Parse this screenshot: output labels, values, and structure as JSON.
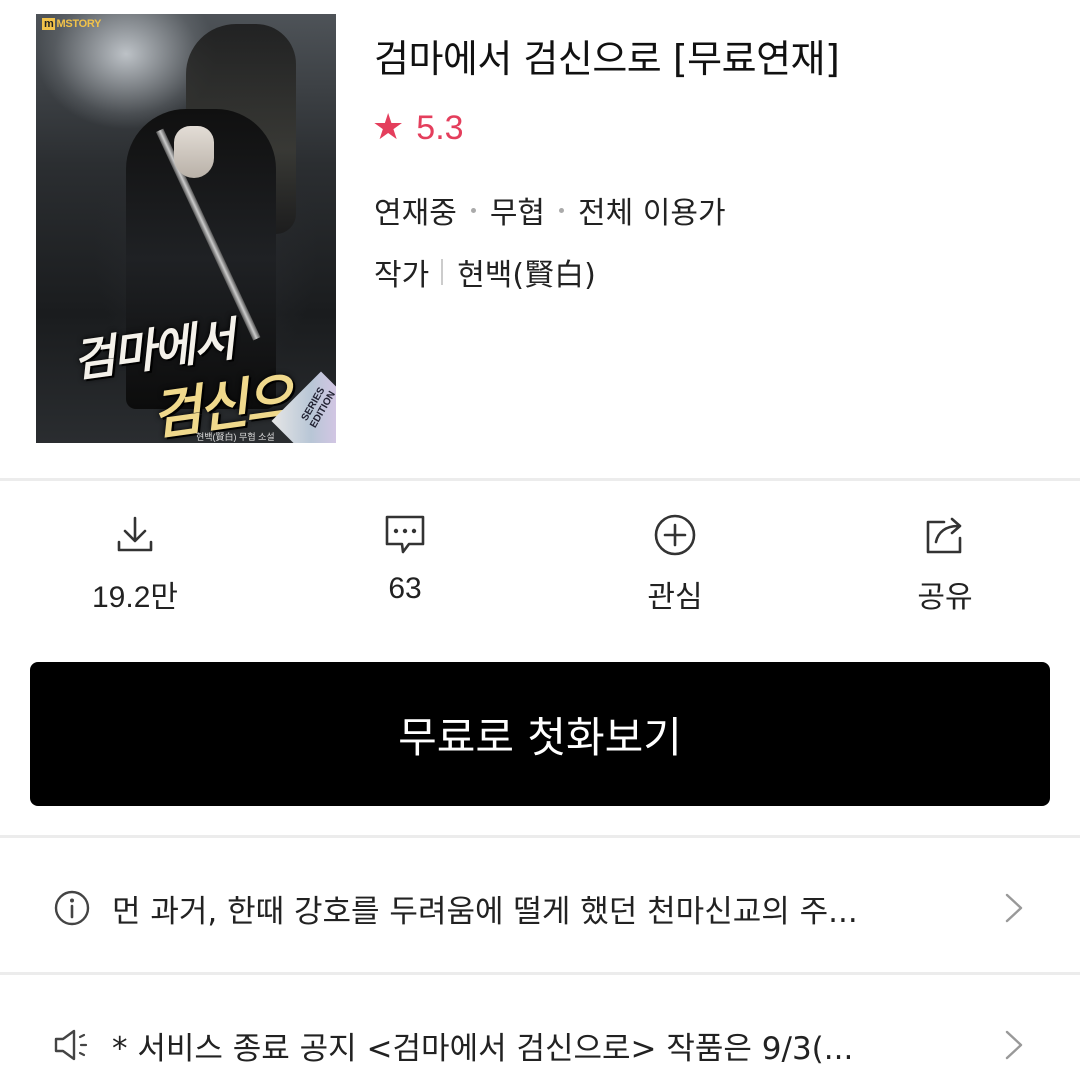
{
  "cover": {
    "publisher_logo": "MSTORY",
    "title_line1": "검마에서",
    "title_line2": "검신으로",
    "edition_badge": "SERIES EDITION",
    "credit": "현백(賢白) 무협 소설"
  },
  "title": "검마에서 검신으로 [무료연재]",
  "rating": {
    "icon": "star-icon",
    "value": "5.3",
    "color": "#e43e5c"
  },
  "meta": {
    "status": "연재중",
    "genre": "무협",
    "age": "전체 이용가"
  },
  "author": {
    "label": "작가",
    "name": "현백(賢白)"
  },
  "actions": [
    {
      "icon": "download-icon",
      "label": "19.2만"
    },
    {
      "icon": "comment-icon",
      "label": "63"
    },
    {
      "icon": "add-circle-icon",
      "label": "관심"
    },
    {
      "icon": "share-icon",
      "label": "공유"
    }
  ],
  "cta": {
    "label": "무료로 첫화보기",
    "background": "#000000",
    "color": "#ffffff"
  },
  "synopsis": {
    "icon": "info-icon",
    "text": "먼 과거, 한때 강호를 두려움에 떨게 했던 천마신교의 주..."
  },
  "notice": {
    "icon": "speaker-icon",
    "text": "* 서비스 종료 공지 <검마에서 검신으로> 작품은 9/3(..."
  }
}
